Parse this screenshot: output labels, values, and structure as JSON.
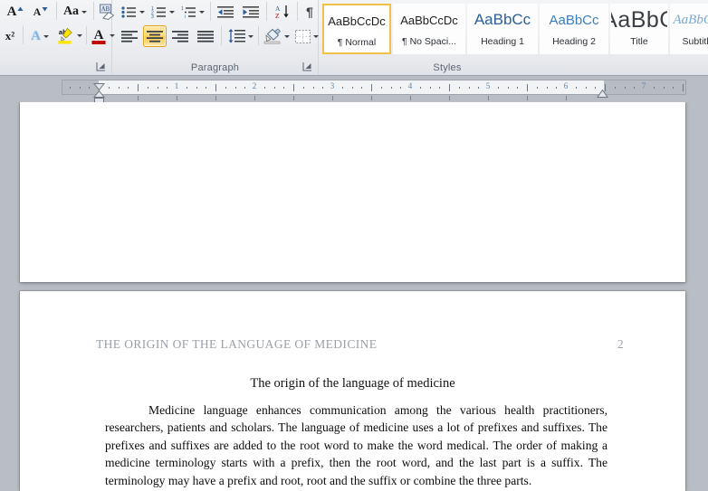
{
  "ribbon": {
    "groups": [
      {
        "id": "font",
        "label": ""
      },
      {
        "id": "paragraph",
        "label": "Paragraph"
      },
      {
        "id": "styles",
        "label": "Styles"
      }
    ],
    "font_group": {
      "label": "",
      "row1": [
        {
          "name": "grow-font-icon",
          "glyph": "A",
          "marker": "up"
        },
        {
          "name": "shrink-font-icon",
          "glyph": "A",
          "marker": "down"
        },
        {
          "name": "change-case-icon",
          "glyph": "Aa",
          "marker": "dropdown"
        },
        {
          "name": "clear-formatting-icon",
          "glyph": "Aa",
          "marker": "eraser"
        }
      ],
      "row2": [
        {
          "name": "superscript-icon",
          "glyph": "x²"
        },
        {
          "name": "text-effects-icon",
          "glyph": "A",
          "marker": "dropdown"
        },
        {
          "name": "text-highlight-color-icon",
          "glyph": "ab",
          "marker": "dropdown",
          "color": "#ffe400"
        },
        {
          "name": "font-color-icon",
          "glyph": "A",
          "marker": "dropdown",
          "color": "#c00000"
        }
      ],
      "dialog_launcher": "font-dialog-launcher"
    },
    "paragraph_group": {
      "label": "Paragraph",
      "row1": [
        {
          "name": "bullets-icon",
          "marker": "dropdown"
        },
        {
          "name": "numbering-icon",
          "marker": "dropdown"
        },
        {
          "name": "multilevel-list-icon",
          "marker": "dropdown"
        },
        {
          "name": "decrease-indent-icon"
        },
        {
          "name": "increase-indent-icon"
        },
        {
          "name": "sort-icon"
        },
        {
          "name": "show-formatting-marks-icon",
          "glyph": "¶"
        }
      ],
      "row2": [
        {
          "name": "align-left-icon",
          "active": false
        },
        {
          "name": "align-center-icon",
          "active": true
        },
        {
          "name": "align-right-icon",
          "active": false
        },
        {
          "name": "justify-icon",
          "active": false
        },
        {
          "name": "line-spacing-icon",
          "marker": "dropdown"
        },
        {
          "name": "shading-icon",
          "marker": "dropdown"
        },
        {
          "name": "borders-icon",
          "marker": "dropdown"
        }
      ],
      "dialog_launcher": "paragraph-dialog-launcher"
    },
    "styles_group": {
      "label": "Styles",
      "items": [
        {
          "name": "style-normal",
          "preview": "AaBbCcDc",
          "label": "¶ Normal",
          "selected": true,
          "cls": "sp-normal"
        },
        {
          "name": "style-no-spacing",
          "preview": "AaBbCcDc",
          "label": "¶ No Spaci...",
          "selected": false,
          "cls": "sp-nospace"
        },
        {
          "name": "style-heading-1",
          "preview": "AaBbCc",
          "label": "Heading 1",
          "selected": false,
          "cls": "sp-h1"
        },
        {
          "name": "style-heading-2",
          "preview": "AaBbCc",
          "label": "Heading 2",
          "selected": false,
          "cls": "sp-h2"
        },
        {
          "name": "style-title",
          "preview": "AaBbC",
          "label": "Title",
          "selected": false,
          "cls": "sp-title"
        },
        {
          "name": "style-subtitle",
          "preview": "AaBbCcI",
          "label": "Subtitle",
          "selected": false,
          "cls": "sp-subtitle"
        }
      ]
    }
  },
  "ruler": {
    "unit": "inches",
    "numbers": [
      "1",
      "1",
      "2",
      "3",
      "4",
      "5",
      "6",
      "7"
    ],
    "visible_numbers": [
      "1",
      "2",
      "3",
      "4",
      "5",
      "6",
      "7"
    ],
    "left_indent_position": "1 inch",
    "right_indent_position": "6.5 inches",
    "first_line_indent": "0.5 inch",
    "tab_stops": [
      "0.5",
      "1",
      "1.5",
      "2",
      "2.5",
      "3",
      "3.5",
      "4",
      "4.5",
      "5",
      "5.5",
      "6"
    ]
  },
  "document": {
    "header_text": "THE ORIGIN OF THE LANGUAGE OF MEDICINE",
    "page_number": "2",
    "title": "The origin of the language of medicine",
    "body": "Medicine language enhances communication among the various health practitioners, researchers, patients and scholars. The language of medicine uses a lot of prefixes and suffixes. The prefixes and suffixes are added to the root word to make the word medical. The order of making a medicine terminology starts with a prefix, then the root word, and the last part is a suffix. The terminology may have a prefix and root, root and the suffix or combine the three parts."
  },
  "colors": {
    "accent_highlight": "#f8c84e",
    "style_blue": "#2a6099",
    "canvas_gray": "#b9bec4",
    "ribbon_bg": "#eceef1"
  }
}
